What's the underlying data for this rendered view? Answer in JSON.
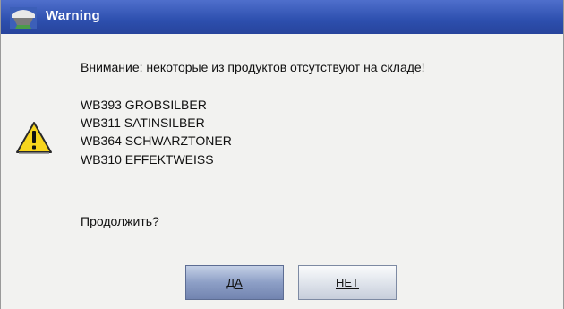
{
  "window": {
    "title": "Warning",
    "title_icon": "app-icon"
  },
  "message": {
    "icon": "warning-icon",
    "headline": "Внимание: некоторые из продуктов отсутствуют на складе!",
    "items": [
      "WB393  GROBSILBER",
      "WB311  SATINSILBER",
      "WB364  SCHWARZTONER",
      "WB310  EFFEKTWEISS"
    ],
    "question": "Продолжить?"
  },
  "buttons": {
    "yes_label": "ДА",
    "no_label": "НЕТ"
  },
  "colors": {
    "titlebar": "#2d4fae",
    "dialog_bg": "#f2f2f0",
    "warning_yellow": "#f7d51d"
  }
}
